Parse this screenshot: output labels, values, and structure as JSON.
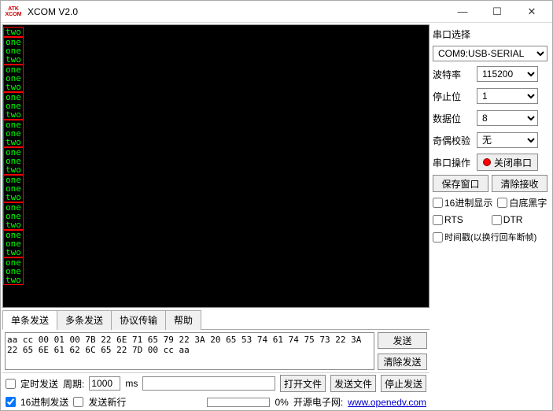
{
  "window": {
    "title": "XCOM V2.0",
    "logo_top": "ATK",
    "logo_bot": "XCOM"
  },
  "terminal_lines": [
    "two",
    "one",
    "one",
    "two",
    "one",
    "one",
    "two",
    "one",
    "one",
    "two",
    "one",
    "one",
    "two",
    "one",
    "one",
    "two",
    "one",
    "one",
    "two",
    "one",
    "one",
    "two",
    "one",
    "one",
    "two",
    "one",
    "one",
    "two"
  ],
  "side": {
    "port_select_label": "串口选择",
    "port_value": "COM9:USB-SERIAL",
    "baud_label": "波特率",
    "baud_value": "115200",
    "stop_label": "停止位",
    "stop_value": "1",
    "data_label": "数据位",
    "data_value": "8",
    "parity_label": "奇偶校验",
    "parity_value": "无",
    "op_label": "串口操作",
    "op_button": "关闭串口",
    "save_window": "保存窗口",
    "clear_recv": "清除接收",
    "hex_display": "16进制显示",
    "white_black": "白底黑字",
    "rts": "RTS",
    "dtr": "DTR",
    "timestamp": "时间戳(以换行回车断帧)"
  },
  "tabs": {
    "single": "单条发送",
    "multi": "多条发送",
    "proto": "协议传输",
    "help": "帮助"
  },
  "send": {
    "text": "aa cc 00 01 00 7B 22 6E 71 65 79 22 3A 20 65 53 74 61 74 75 73 22 3A 22 65 6E 61 62 6C 65 22 7D 00 cc aa",
    "send_btn": "发送",
    "clear_btn": "清除发送"
  },
  "bottom": {
    "timed_send": "定时发送",
    "period_label": "周期:",
    "period_value": "1000",
    "period_unit": "ms",
    "open_file": "打开文件",
    "send_file": "发送文件",
    "stop_send": "停止发送",
    "hex_send": "16进制发送",
    "send_newline": "发送新行",
    "progress": "0%",
    "footer_text": "开源电子网:",
    "footer_link": "www.openedv.com"
  }
}
